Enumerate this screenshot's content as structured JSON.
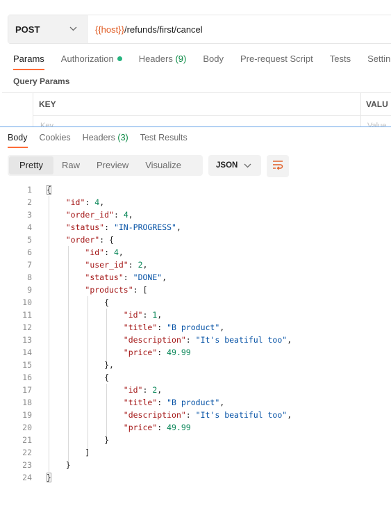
{
  "request": {
    "method": "POST",
    "url_variable": "{{host}}",
    "url_path": "/refunds/first/cancel",
    "tabs": [
      {
        "label": "Params"
      },
      {
        "label": "Authorization"
      },
      {
        "label": "Headers",
        "count": "(9)"
      },
      {
        "label": "Body"
      },
      {
        "label": "Pre-request Script"
      },
      {
        "label": "Tests"
      },
      {
        "label": "Settin"
      }
    ],
    "query_params_title": "Query Params",
    "table": {
      "key_header": "KEY",
      "value_header": "VALU",
      "key_placeholder": "Key",
      "value_placeholder": "Value"
    }
  },
  "response": {
    "tabs": [
      {
        "label": "Body"
      },
      {
        "label": "Cookies"
      },
      {
        "label": "Headers",
        "count": "(3)"
      },
      {
        "label": "Test Results"
      }
    ],
    "views": [
      "Pretty",
      "Raw",
      "Preview",
      "Visualize"
    ],
    "format": "JSON"
  },
  "colors": {
    "accent": "#ff6c37",
    "auth_dot": "#26b47f",
    "count": "#0b8a45"
  },
  "code_lines": [
    "{",
    "    \"id\": 4,",
    "    \"order_id\": 4,",
    "    \"status\": \"IN-PROGRESS\",",
    "    \"order\": {",
    "        \"id\": 4,",
    "        \"user_id\": 2,",
    "        \"status\": \"DONE\",",
    "        \"products\": [",
    "            {",
    "                \"id\": 1,",
    "                \"title\": \"B product\",",
    "                \"description\": \"It's beatiful too\",",
    "                \"price\": 49.99",
    "            },",
    "            {",
    "                \"id\": 2,",
    "                \"title\": \"B product\",",
    "                \"description\": \"It's beatiful too\",",
    "                \"price\": 49.99",
    "            }",
    "        ]",
    "    }",
    "}"
  ]
}
